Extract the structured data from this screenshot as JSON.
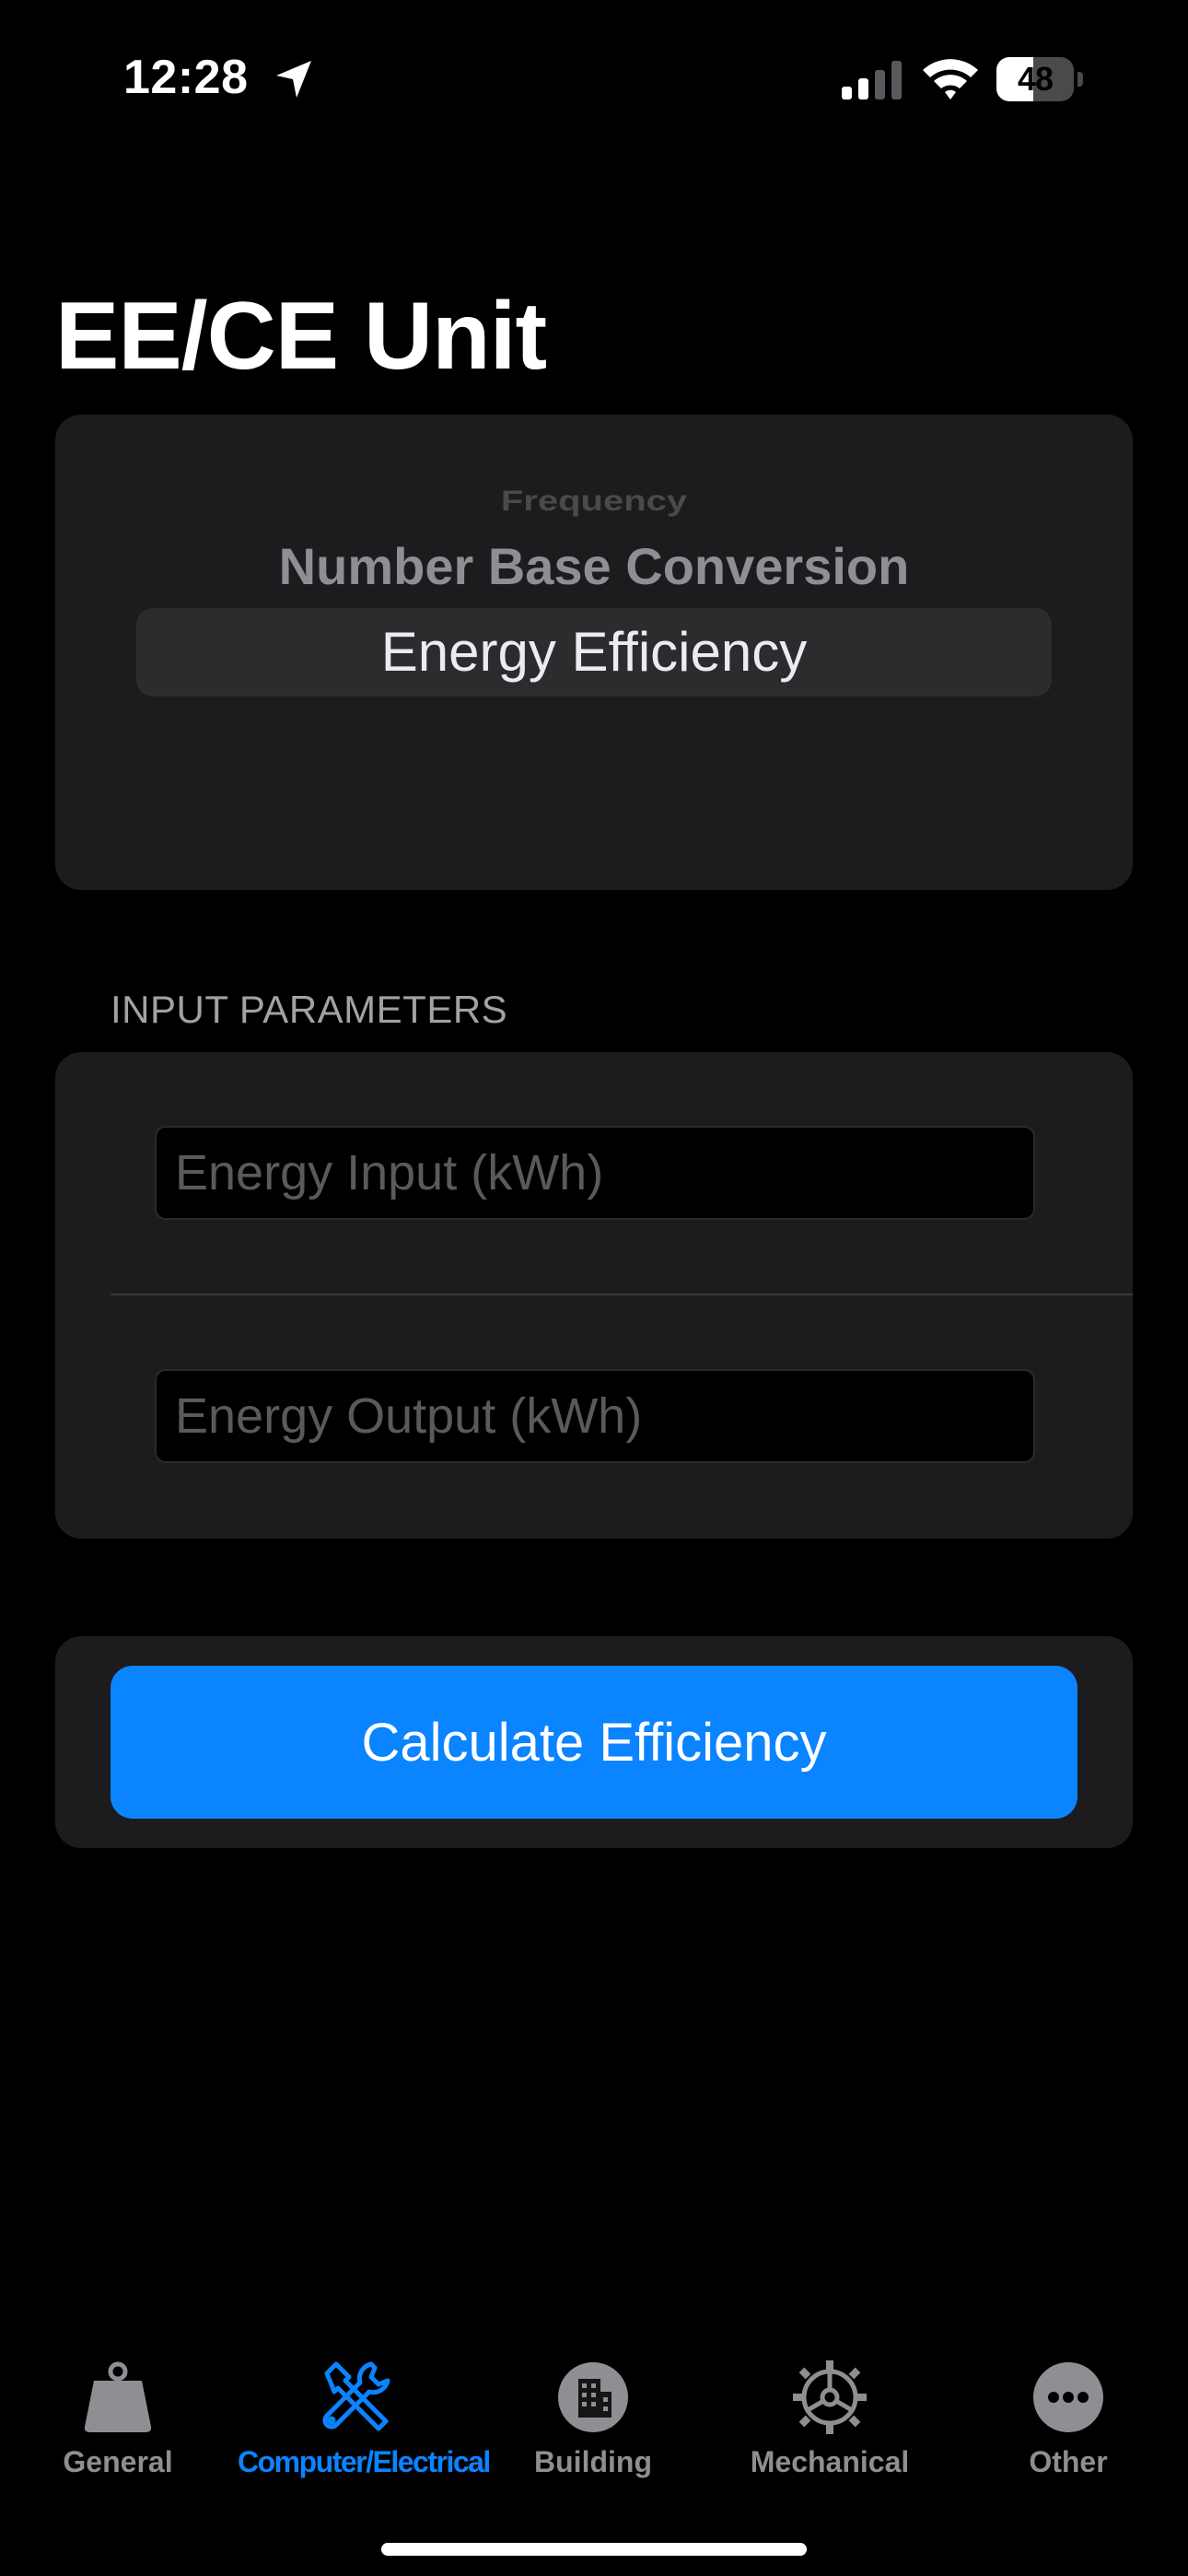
{
  "status_bar": {
    "time": "12:28",
    "battery_level": 48,
    "battery_text": "48"
  },
  "header": {
    "title": "EE/CE Unit"
  },
  "picker": {
    "items": [
      "Frequency",
      "Number Base Conversion",
      "Energy Efficiency"
    ],
    "selected": "Energy Efficiency"
  },
  "inputs_section": {
    "header": "INPUT PARAMETERS",
    "energy_input": {
      "value": "",
      "placeholder": "Energy Input (kWh)"
    },
    "energy_output": {
      "value": "",
      "placeholder": "Energy Output (kWh)"
    }
  },
  "actions": {
    "calculate_label": "Calculate Efficiency"
  },
  "tab_bar": {
    "active": "Computer/Electrical",
    "tabs": [
      {
        "label": "General",
        "icon": "weight-icon"
      },
      {
        "label": "Computer/Electrical",
        "icon": "tools-icon"
      },
      {
        "label": "Building",
        "icon": "building-icon"
      },
      {
        "label": "Mechanical",
        "icon": "gear-icon"
      },
      {
        "label": "Other",
        "icon": "ellipsis-icon"
      }
    ]
  },
  "colors": {
    "accent": "#0a84ff",
    "background": "#000000",
    "card": "#1c1c1e",
    "inactive_tab": "#8e8e93"
  }
}
